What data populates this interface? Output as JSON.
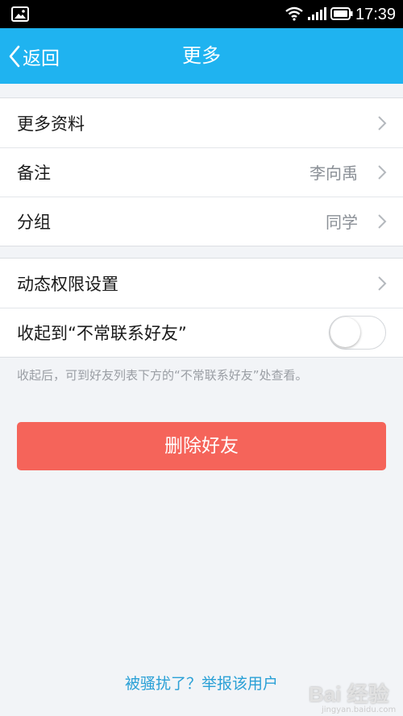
{
  "status_bar": {
    "time": "17:39"
  },
  "nav": {
    "back_label": "返回",
    "title": "更多"
  },
  "group1": {
    "items": [
      {
        "label": "更多资料",
        "value": ""
      },
      {
        "label": "备注",
        "value": "李向禹"
      },
      {
        "label": "分组",
        "value": "同学"
      }
    ]
  },
  "group2": {
    "permission_label": "动态权限设置",
    "collapse_label": "收起到“不常联系好友”",
    "collapse_toggle_on": false
  },
  "hint": "收起后，可到好友列表下方的“不常联系好友”处查看。",
  "delete_button_label": "删除好友",
  "report_link": "被骚扰了？举报该用户",
  "watermark": {
    "text": "Bai 经验",
    "url": "jingyan.baidu.com"
  },
  "colors": {
    "nav_bg": "#1fb3f0",
    "delete_bg": "#f5645a",
    "link": "#2aa0d6",
    "page_bg": "#f2f4f7"
  }
}
